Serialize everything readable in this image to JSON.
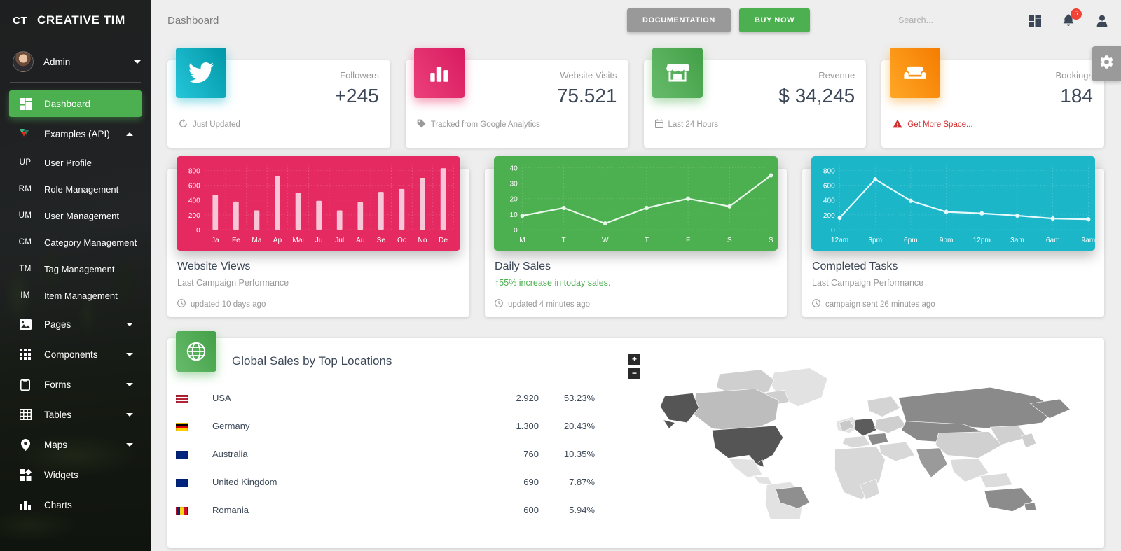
{
  "brand": {
    "mark": "CT",
    "name": "CREATIVE TIM"
  },
  "user": {
    "name": "Admin",
    "avatar_icon": "avatar-image",
    "caret_icon": "chevron-down-icon"
  },
  "sidebar": {
    "items": [
      {
        "label": "Dashboard",
        "icon": "dashboard-grid-icon",
        "active": true
      },
      {
        "label": "Examples (API)",
        "icon": "vue-laravel-logo-icon",
        "expanded": true
      },
      {
        "label": "User Profile",
        "mini": "UP"
      },
      {
        "label": "Role Management",
        "mini": "RM"
      },
      {
        "label": "User Management",
        "mini": "UM"
      },
      {
        "label": "Category Management",
        "mini": "CM"
      },
      {
        "label": "Tag Management",
        "mini": "TM"
      },
      {
        "label": "Item Management",
        "mini": "IM"
      },
      {
        "label": "Pages",
        "icon": "image-icon",
        "caret": true
      },
      {
        "label": "Components",
        "icon": "grid-dots-icon",
        "caret": true
      },
      {
        "label": "Forms",
        "icon": "clipboard-icon",
        "caret": true
      },
      {
        "label": "Tables",
        "icon": "table-grid-icon",
        "caret": true
      },
      {
        "label": "Maps",
        "icon": "map-pin-icon",
        "caret": true
      },
      {
        "label": "Widgets",
        "icon": "widgets-icon"
      },
      {
        "label": "Charts",
        "icon": "chart-icon"
      }
    ]
  },
  "topbar": {
    "page_title": "Dashboard",
    "documentation_label": "DOCUMENTATION",
    "buy_now_label": "BUY NOW",
    "search_placeholder": "Search...",
    "search_value": "",
    "dashboard_icon": "apps-grid-icon",
    "notifications_icon": "bell-icon",
    "notifications_count": "5",
    "profile_icon": "person-icon",
    "settings_icon": "gear-icon"
  },
  "stats": [
    {
      "icon": "twitter-icon",
      "color": "#17b5cf",
      "label": "Followers",
      "value": "+245",
      "foot_icon": "refresh-icon",
      "foot": "Just Updated"
    },
    {
      "icon": "bar-chart-icon",
      "color": "#e52a62",
      "label": "Website Visits",
      "value": "75.521",
      "foot_icon": "tag-icon",
      "foot": "Tracked from Google Analytics"
    },
    {
      "icon": "store-icon",
      "color": "#4caf50",
      "label": "Revenue",
      "value": "$ 34,245",
      "foot_icon": "calendar-icon",
      "foot": "Last 24 Hours"
    },
    {
      "icon": "sofa-icon",
      "color": "#f79c1e",
      "label": "Bookings",
      "value": "184",
      "foot_icon": "warning-icon",
      "foot": "Get More Space...",
      "foot_color": "#d32f2f"
    }
  ],
  "charts": [
    {
      "title": "Website Views",
      "subtitle": "Last Campaign Performance",
      "foot_icon": "clock-icon",
      "foot": "updated 10 days ago",
      "color": "#e52a62"
    },
    {
      "title": "Daily Sales",
      "subtitle": "55% increase in today sales.",
      "subtitle_arrow": "↑",
      "foot_icon": "clock-icon",
      "foot": "updated 4 minutes ago",
      "color": "#4caf50"
    },
    {
      "title": "Completed Tasks",
      "subtitle": "Last Campaign Performance",
      "foot_icon": "clock-icon",
      "foot": "campaign sent 26 minutes ago",
      "color": "#1cb6c9"
    }
  ],
  "chart_data": [
    {
      "type": "bar",
      "title": "Website Views",
      "categories": [
        "Ja",
        "Fe",
        "Ma",
        "Ap",
        "Mai",
        "Ju",
        "Jul",
        "Au",
        "Se",
        "Oc",
        "No",
        "De"
      ],
      "values": [
        470,
        380,
        260,
        720,
        500,
        390,
        260,
        370,
        510,
        550,
        700,
        830
      ],
      "yticks": [
        0,
        200,
        400,
        600,
        800
      ],
      "ylim": [
        0,
        880
      ],
      "xlabel": "",
      "ylabel": "",
      "grid": true,
      "legend": "none",
      "bar_color": "#f8c6d7",
      "background": "#e52a62"
    },
    {
      "type": "line",
      "title": "Daily Sales",
      "categories": [
        "M",
        "T",
        "W",
        "T",
        "F",
        "S",
        "S"
      ],
      "values": [
        9,
        14,
        4,
        14,
        20,
        15,
        35
      ],
      "yticks": [
        0,
        10,
        20,
        30,
        40
      ],
      "ylim": [
        0,
        42
      ],
      "xlabel": "",
      "ylabel": "",
      "grid": true,
      "legend": "none",
      "line_color": "#e9f7ea",
      "background": "#4caf50"
    },
    {
      "type": "line",
      "title": "Completed Tasks",
      "categories": [
        "12am",
        "3pm",
        "6pm",
        "9pm",
        "12pm",
        "3am",
        "6am",
        "9am"
      ],
      "values": [
        160,
        680,
        390,
        240,
        220,
        190,
        150,
        140
      ],
      "yticks": [
        0,
        200,
        400,
        600,
        800
      ],
      "ylim": [
        0,
        880
      ],
      "xlabel": "",
      "ylabel": "",
      "grid": true,
      "legend": "none",
      "line_color": "#e6fafd",
      "background": "#1cb6c9"
    }
  ],
  "global_sales": {
    "title": "Global Sales by Top Locations",
    "icon": "globe-icon",
    "rows": [
      {
        "flag": "us-flag",
        "country": "USA",
        "sales": "2.920",
        "percent": "53.23%"
      },
      {
        "flag": "de-flag",
        "country": "Germany",
        "sales": "1.300",
        "percent": "20.43%"
      },
      {
        "flag": "au-flag",
        "country": "Australia",
        "sales": "760",
        "percent": "10.35%"
      },
      {
        "flag": "gb-flag",
        "country": "United Kingdom",
        "sales": "690",
        "percent": "7.87%"
      },
      {
        "flag": "ro-flag",
        "country": "Romania",
        "sales": "600",
        "percent": "5.94%"
      }
    ],
    "map_zoom_in": "+",
    "map_zoom_out": "−"
  }
}
